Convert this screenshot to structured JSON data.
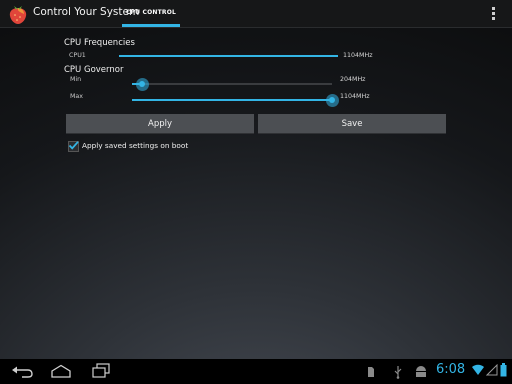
{
  "app": {
    "title": "Control Your System",
    "icon": "strawberry-icon",
    "tab_label": "CPU CONTROL",
    "accent_color": "#33b5e5"
  },
  "cpu_frequencies": {
    "title": "CPU Frequencies",
    "cpu1": {
      "label": "CPU1",
      "value": "1104MHz",
      "level": 1.0
    }
  },
  "cpu_governor": {
    "title": "CPU Governor",
    "min": {
      "label": "Min",
      "value": "204MHz",
      "level": 0.05
    },
    "max": {
      "label": "Max",
      "value": "1104MHz",
      "level": 1.0
    }
  },
  "buttons": {
    "apply": "Apply",
    "save": "Save"
  },
  "boot_option": {
    "label": "Apply saved settings on boot",
    "checked": true
  },
  "status_bar": {
    "time": "6:08"
  }
}
